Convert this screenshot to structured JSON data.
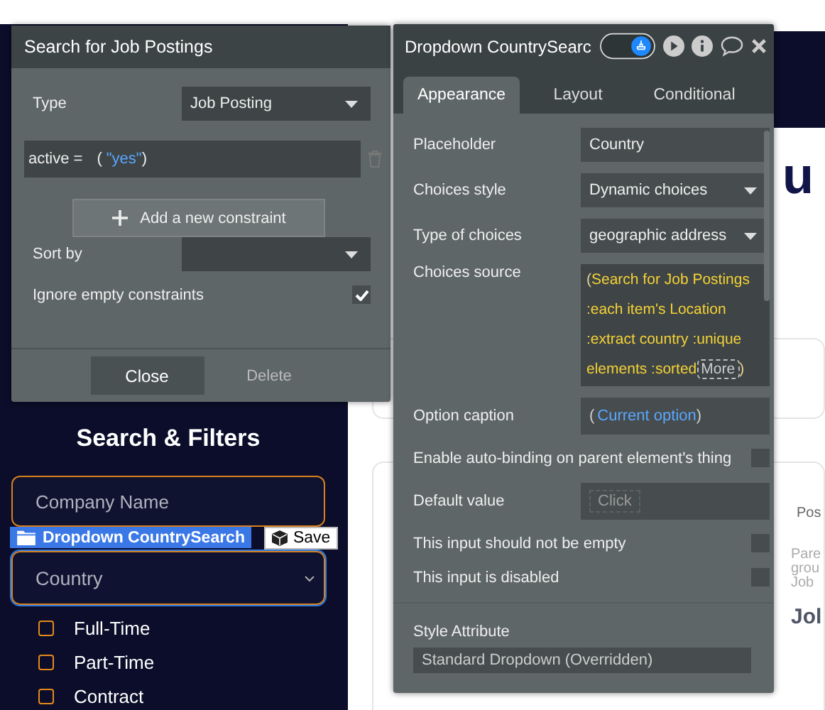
{
  "page": {
    "sidebar": {
      "heading": "Search & Filters",
      "company_placeholder": "Company Name",
      "element_tag": {
        "label": "Dropdown CountrySearch",
        "save": "Save"
      },
      "country_placeholder": "Country",
      "job_types": [
        {
          "label": "Full-Time",
          "checked": false
        },
        {
          "label": "Part-Time",
          "checked": false
        },
        {
          "label": "Contract",
          "checked": false
        }
      ]
    },
    "content": {
      "heading_fragment": "u",
      "card_label": "Pos",
      "card_text": [
        "Pare",
        "grou",
        "Job"
      ],
      "card_title": "Jol"
    }
  },
  "search_dialog": {
    "title": "Search for Job Postings",
    "type_label": "Type",
    "type_value": "Job Posting",
    "constraint": {
      "field": "active =",
      "open": "(",
      "value": "\"yes\"",
      "close": ")"
    },
    "add_button": "Add a new constraint",
    "sort_label": "Sort by",
    "ignore_empty": {
      "label": "Ignore empty constraints",
      "checked": true
    },
    "buttons": [
      {
        "label": "Close",
        "kind": "primary"
      },
      {
        "label": "Delete",
        "kind": "secondary"
      }
    ]
  },
  "property_editor": {
    "title": "Dropdown CountrySearc",
    "toggle_on": true,
    "tabs": [
      {
        "label": "Appearance",
        "selected": true
      },
      {
        "label": "Layout",
        "selected": false
      },
      {
        "label": "Conditional",
        "selected": false
      }
    ],
    "rows": [
      {
        "kind": "input",
        "label": "Placeholder",
        "value": "Country"
      },
      {
        "kind": "select",
        "label": "Choices style",
        "value": "Dynamic choices"
      },
      {
        "kind": "select",
        "label": "Type of choices",
        "value": "geographic address"
      },
      {
        "kind": "expression",
        "label": "Choices source",
        "open": "(",
        "value": "Search for Job Postings :each item's Location :extract country :unique elements :sorted",
        "more": "More",
        "close": ")"
      },
      {
        "kind": "caption",
        "label": "Option caption",
        "open": "(",
        "value": "Current option",
        "close": ")"
      },
      {
        "kind": "checkbox",
        "label": "Enable auto-binding on parent element's thing",
        "checked": false
      },
      {
        "kind": "click",
        "label": "Default value",
        "value": "Click"
      },
      {
        "kind": "checkbox",
        "label": "This input should not be empty",
        "checked": false
      },
      {
        "kind": "checkbox",
        "label": "This input is disabled",
        "checked": false
      }
    ],
    "style_label": "Style Attribute",
    "style_value": "Standard Dropdown (Overridden)"
  }
}
